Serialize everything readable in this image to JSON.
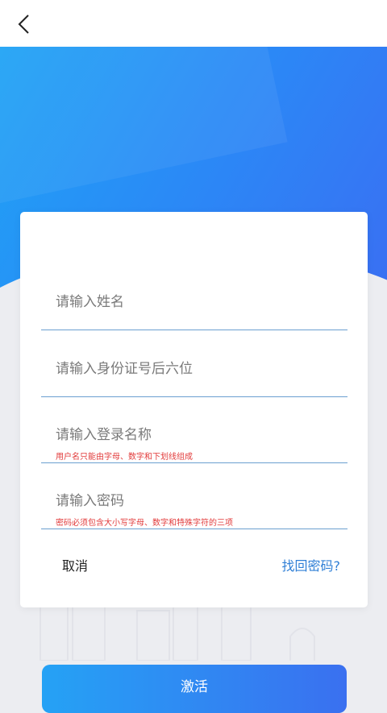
{
  "header": {
    "back_icon": "chevron-left-icon"
  },
  "form": {
    "name_placeholder": "请输入姓名",
    "id_placeholder": "请输入身份证号后六位",
    "username_placeholder": "请输入登录名称",
    "username_hint": "用户名只能由字母、数字和下划线组成",
    "password_placeholder": "请输入密码",
    "password_hint": "密码必须包含大小写字母、数字和特殊字符的三项",
    "cancel_label": "取消",
    "recover_label": "找回密码?"
  },
  "login_label": "激活",
  "colors": {
    "accent": "#2b88f6",
    "link": "#2f7fd6",
    "hint": "#e23b3b"
  }
}
